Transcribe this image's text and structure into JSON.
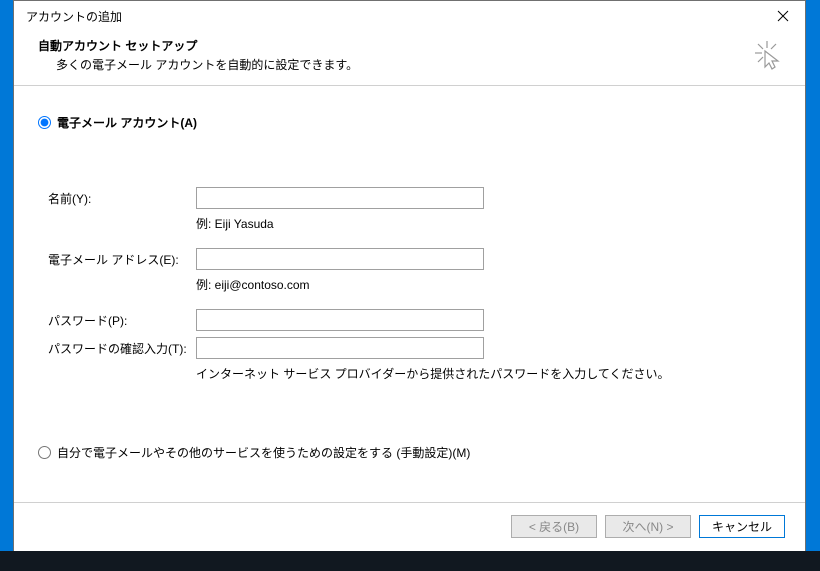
{
  "dialog": {
    "title": "アカウントの追加"
  },
  "header": {
    "title": "自動アカウント セットアップ",
    "subtitle": "多くの電子メール アカウントを自動的に設定できます。"
  },
  "radio_email": {
    "label": "電子メール アカウント(A)"
  },
  "form": {
    "name_label": "名前(Y):",
    "name_value": "",
    "name_hint": "例: Eiji Yasuda",
    "email_label": "電子メール アドレス(E):",
    "email_value": "",
    "email_hint": "例: eiji@contoso.com",
    "password_label": "パスワード(P):",
    "password_value": "",
    "password_confirm_label": "パスワードの確認入力(T):",
    "password_confirm_value": "",
    "password_hint": "インターネット サービス プロバイダーから提供されたパスワードを入力してください。"
  },
  "radio_manual": {
    "label": "自分で電子メールやその他のサービスを使うための設定をする (手動設定)(M)"
  },
  "buttons": {
    "back": "< 戻る(B)",
    "next": "次へ(N) >",
    "cancel": "キャンセル"
  }
}
